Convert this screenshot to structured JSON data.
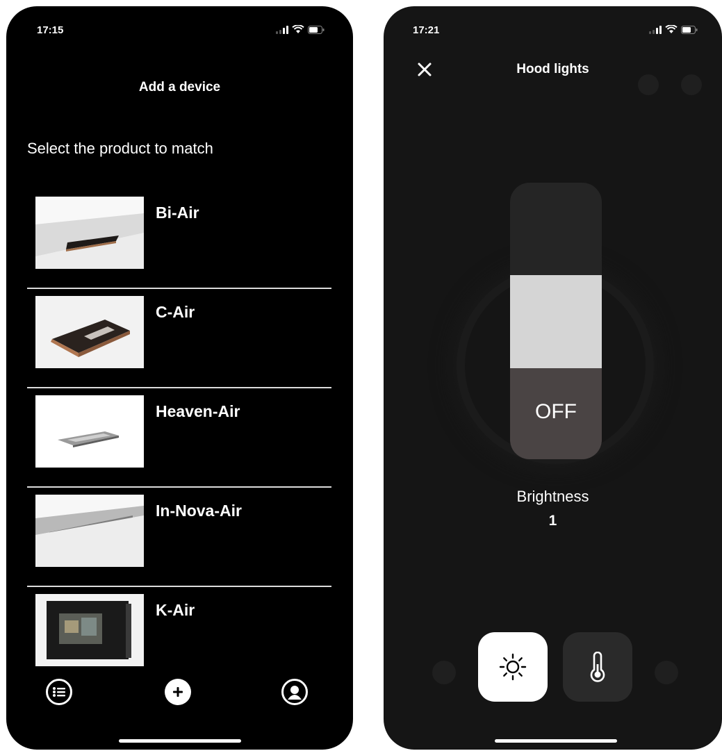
{
  "left_screen": {
    "status": {
      "time": "17:15"
    },
    "title": "Add a device",
    "subtitle": "Select the product to match",
    "products": [
      {
        "name": "Bi-Air"
      },
      {
        "name": "C-Air"
      },
      {
        "name": "Heaven-Air"
      },
      {
        "name": "In-Nova-Air"
      },
      {
        "name": "K-Air"
      }
    ],
    "tabbar": [
      {
        "icon": "list-icon"
      },
      {
        "icon": "add-icon"
      },
      {
        "icon": "profile-icon"
      }
    ]
  },
  "right_screen": {
    "status": {
      "time": "17:21"
    },
    "title": "Hood lights",
    "close_icon": "close-icon",
    "slider": {
      "state_label": "OFF"
    },
    "brightness": {
      "label": "Brightness",
      "value": "1"
    },
    "modes": [
      {
        "icon": "sun-icon",
        "selected": true
      },
      {
        "icon": "thermometer-icon",
        "selected": false
      }
    ]
  },
  "colors": {
    "background_left": "#000000",
    "background_right": "#151515",
    "slider_thumb": "#d5d5d5",
    "slider_off": "#4a4444",
    "text": "#ffffff"
  }
}
